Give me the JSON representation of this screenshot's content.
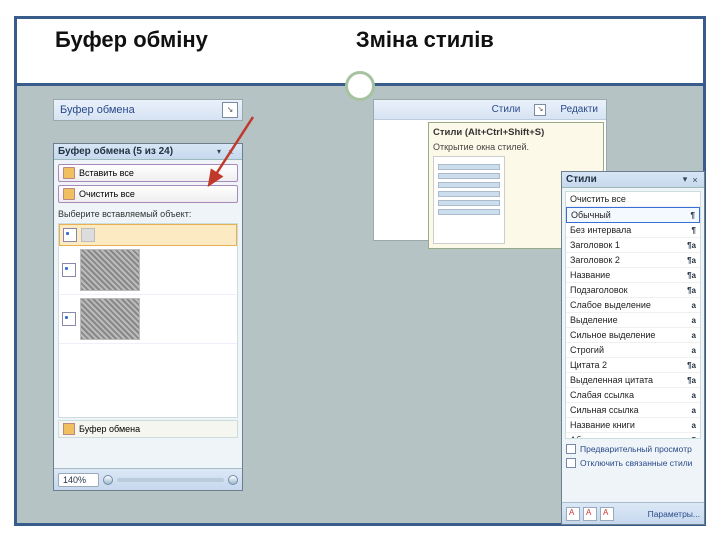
{
  "headings": {
    "left": "Буфер обміну",
    "right": "Зміна стилів"
  },
  "ribbon": {
    "clipboard": "Буфер обмена",
    "styles": "Стили",
    "edit": "Редакти"
  },
  "clipPane": {
    "title": "Буфер обмена (5 из 24)",
    "pasteAll": "Вставить все",
    "clearAll": "Очистить все",
    "instruction": "Выберите вставляемый объект:",
    "optionsLabel": "Буфер обмена",
    "zoom": "140%"
  },
  "tooltip": {
    "title": "Стили (Alt+Ctrl+Shift+S)",
    "body": "Открытие окна стилей."
  },
  "stylesPane": {
    "title": "Стили",
    "clearAll": "Очистить все",
    "items": [
      {
        "n": "Обычный",
        "t": "¶"
      },
      {
        "n": "Без интервала",
        "t": "¶"
      },
      {
        "n": "Заголовок 1",
        "t": "¶a"
      },
      {
        "n": "Заголовок 2",
        "t": "¶a"
      },
      {
        "n": "Название",
        "t": "¶a"
      },
      {
        "n": "Подзаголовок",
        "t": "¶a"
      },
      {
        "n": "Слабое выделение",
        "t": "a"
      },
      {
        "n": "Выделение",
        "t": "a"
      },
      {
        "n": "Сильное выделение",
        "t": "a"
      },
      {
        "n": "Строгий",
        "t": "a"
      },
      {
        "n": "Цитата 2",
        "t": "¶a"
      },
      {
        "n": "Выделенная цитата",
        "t": "¶a"
      },
      {
        "n": "Слабая ссылка",
        "t": "a"
      },
      {
        "n": "Сильная ссылка",
        "t": "a"
      },
      {
        "n": "Название книги",
        "t": "a"
      },
      {
        "n": "Абзац списка",
        "t": "¶"
      }
    ],
    "preview": "Предварительный просмотр",
    "disableLinked": "Отключить связанные стили",
    "params": "Параметры..."
  }
}
